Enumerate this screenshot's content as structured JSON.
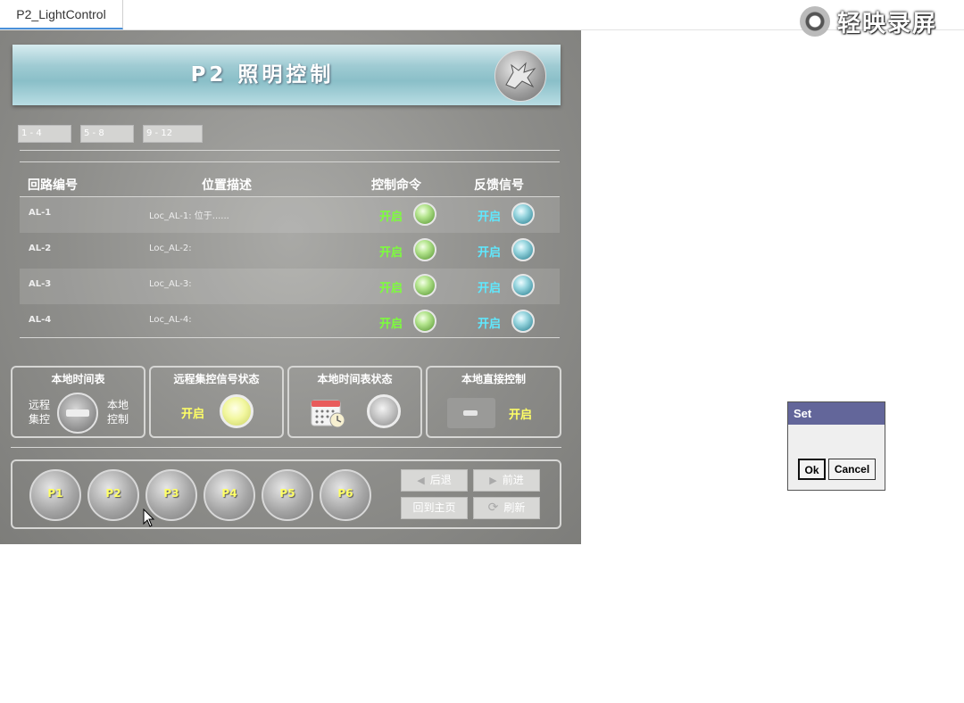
{
  "window": {
    "tab_title": "P2_LightControl"
  },
  "watermark": {
    "text": "轻映录屏"
  },
  "header": {
    "title": "P2 照明控制"
  },
  "range_buttons": [
    "1 - 4",
    "5 - 8",
    "9 - 12"
  ],
  "table": {
    "columns": [
      "回路编号",
      "位置描述",
      "控制命令",
      "反馈信号"
    ],
    "rows": [
      {
        "id": "AL-1",
        "location": "Loc_AL-1: 位于......",
        "command": "开启",
        "feedback": "开启"
      },
      {
        "id": "AL-2",
        "location": "Loc_AL-2:",
        "command": "开启",
        "feedback": "开启"
      },
      {
        "id": "AL-3",
        "location": "Loc_AL-3:",
        "command": "开启",
        "feedback": "开启"
      },
      {
        "id": "AL-4",
        "location": "Loc_AL-4:",
        "command": "开启",
        "feedback": "开启"
      }
    ]
  },
  "status_boxes": {
    "schedule": {
      "title": "本地时间表",
      "left_label_1": "远程",
      "left_label_2": "集控",
      "right_label_1": "本地",
      "right_label_2": "控制"
    },
    "remote": {
      "title": "远程集控信号状态",
      "state": "开启"
    },
    "local_schedule": {
      "title": "本地时间表状态"
    },
    "direct": {
      "title": "本地直接控制",
      "state": "开启"
    }
  },
  "nav": {
    "pages": [
      "P1",
      "P2",
      "P3",
      "P4",
      "P5",
      "P6"
    ],
    "back": "后退",
    "forward": "前进",
    "home": "回到主页",
    "refresh": "刷新"
  },
  "dialog": {
    "title": "Set",
    "ok": "Ok",
    "cancel": "Cancel"
  },
  "colors": {
    "command_on": "#7cff3a",
    "feedback_on": "#5fe9ff",
    "status_on": "#ffff66",
    "dialog_title_bg": "#63669a"
  }
}
